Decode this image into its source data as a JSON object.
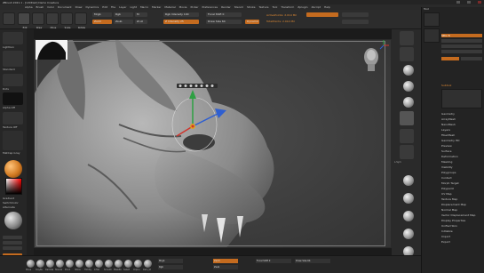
{
  "app": {
    "title": "ZBrush 2021.1 - [Untitled]  Demo Creature",
    "window_controls": [
      "_",
      "□",
      "×"
    ]
  },
  "menu": [
    "Alpha",
    "Brush",
    "Color",
    "Document",
    "Draw",
    "Dynamics",
    "Edit",
    "File",
    "Layer",
    "Light",
    "Macro",
    "Marker",
    "Material",
    "Movie",
    "Picker",
    "Preferences",
    "Render",
    "Stencil",
    "Stroke",
    "Texture",
    "Tool",
    "Transform",
    "Zplugin",
    "Zscript",
    "Help"
  ],
  "top_shelf": {
    "buttons": [
      "Edit",
      "Draw",
      "Move",
      "Scale",
      "Rotate"
    ],
    "mrgb": "Mrgb",
    "rgb": "Rgb",
    "m": "M",
    "zadd": "Zadd",
    "zsub": "Zsub",
    "zcut": "Zcut",
    "rgb_intensity": "Rgb Intensity 100",
    "z_intensity": "Z Intensity 25",
    "focal_shift": "Focal Shift 0",
    "draw_size": "Draw Size 64",
    "dynamic": "Dynamic",
    "active_points": "ActivePoints: 2.014 Mil",
    "total_points": "TotalPoints: 2.014 Mil"
  },
  "left_tray": {
    "labels": [
      "Lightbox",
      "Brush",
      "Standard",
      "Stroke",
      "Dots",
      "Alpha",
      "Alpha Off",
      "Texture",
      "Texture Off",
      "Material",
      "MatCap Gray",
      "Gradient",
      "SwitchColor",
      "Alternate"
    ]
  },
  "right_shelf": {
    "labels": [
      "Persp",
      "Floor",
      "Local",
      "L.Sym",
      "Frame",
      "Move",
      "Scale",
      "Rotate",
      "Line Fill",
      "PolyF",
      "Transp",
      "Ghost",
      "Solo",
      "Xpose"
    ]
  },
  "palette": {
    "header": "Tool",
    "items": [
      "Load Tool",
      "Save As",
      "Copy Tool",
      "Paste Tool",
      "Import",
      "Export",
      "Clone",
      "Make PolyMesh3D",
      "GoZ",
      "All",
      "Visible",
      "R",
      "Lightbox > Tools",
      "Subtool",
      "Geometry",
      "ArrayMesh",
      "NanoMesh",
      "Layers",
      "FiberMesh",
      "Geometry HD",
      "Preview",
      "Surface",
      "Deformation",
      "Masking",
      "Visibility",
      "Polygroups",
      "Contact",
      "Morph Target",
      "Polypaint",
      "UV Map",
      "Texture Map",
      "Displacement Map",
      "Normal Map",
      "Vector Displacement Map",
      "Display Properties",
      "Unified Skin",
      "Initialize",
      "Import",
      "Export"
    ],
    "subtool_title": "Subtool",
    "slider_value": "SDiv 6",
    "accent": "#c46b1f"
  },
  "bottom": {
    "brushes": [
      "Move",
      "ClayBuildup",
      "DamStandard",
      "Standard",
      "Pinch",
      "hPolish",
      "TrimDynamic",
      "Inflat",
      "Smooth",
      "MaskPen",
      "SelectRect",
      "ClipCurve",
      "Dam_Std"
    ],
    "fields": [
      "Mrgb",
      "Rgb",
      "Zadd",
      "Zsub",
      "Focal Shift 0",
      "Draw Size 64"
    ]
  },
  "colors": {
    "accent": "#c46b1f",
    "gizmo_red": "#d0342c",
    "gizmo_green": "#2ea043",
    "gizmo_blue": "#2f5fd0"
  }
}
